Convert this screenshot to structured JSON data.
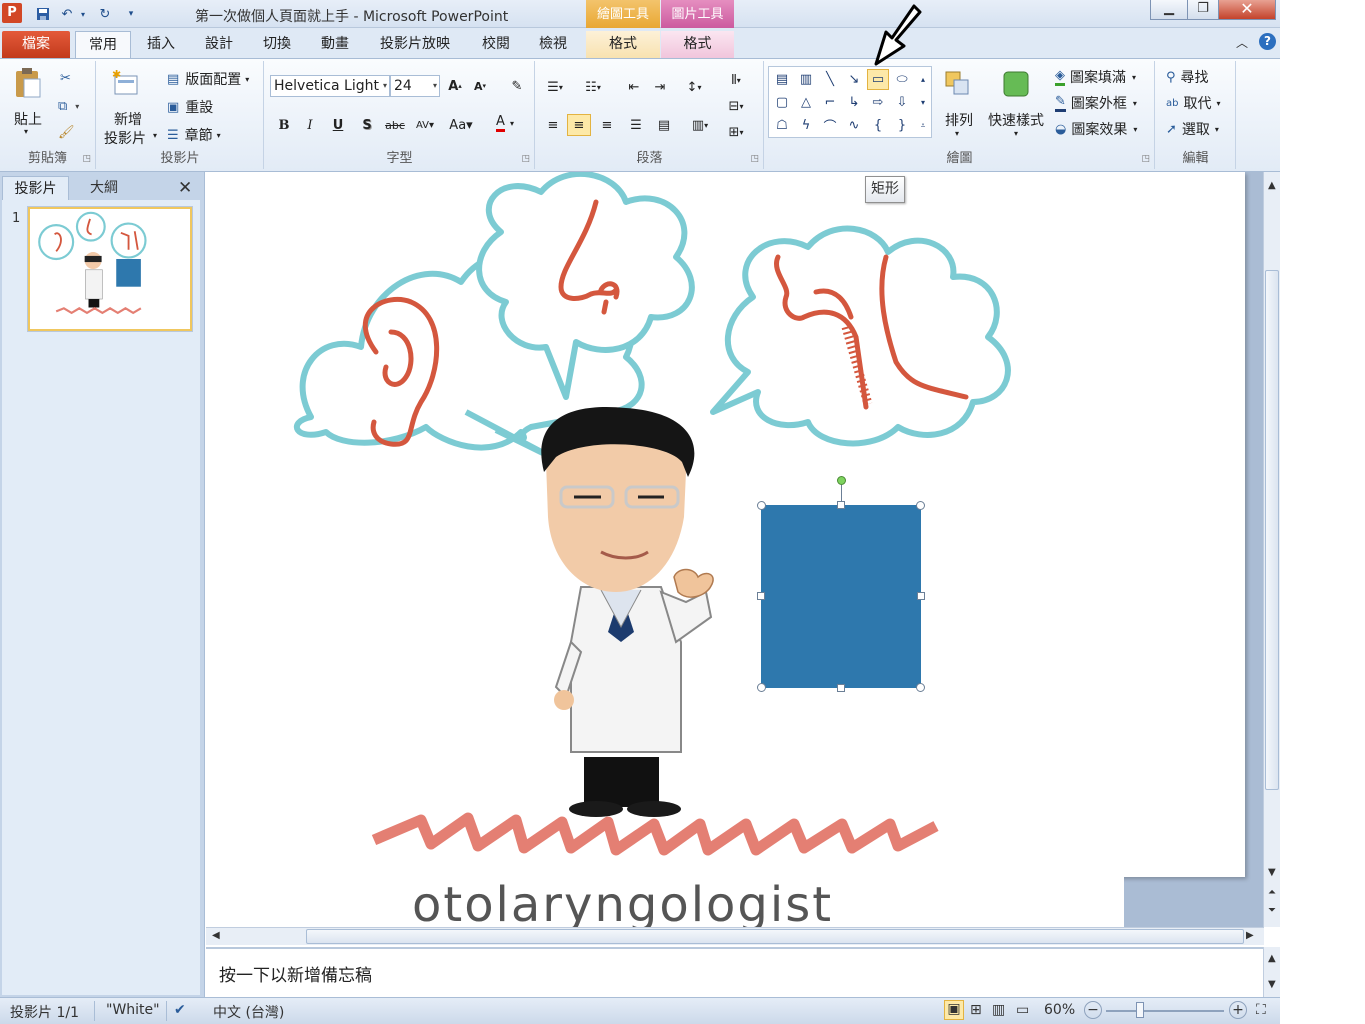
{
  "window": {
    "title": "第一次做個人頁面就上手 - Microsoft PowerPoint",
    "app_icon": "P",
    "context_headers": [
      "繪圖工具",
      "圖片工具"
    ]
  },
  "tabs": [
    "檔案",
    "常用",
    "插入",
    "設計",
    "切換",
    "動畫",
    "投影片放映",
    "校閱",
    "檢視",
    "格式",
    "格式"
  ],
  "ribbon": {
    "clipboard": {
      "paste": "貼上",
      "label": "剪貼簿"
    },
    "slides": {
      "new_slide_1": "新增",
      "new_slide_2": "投影片",
      "layout": "版面配置",
      "reset": "重設",
      "section": "章節",
      "label": "投影片"
    },
    "font": {
      "family": "Helvetica Light",
      "size": "24",
      "label": "字型"
    },
    "paragraph": {
      "label": "段落"
    },
    "drawing": {
      "arrange": "排列",
      "quick_styles": "快速樣式",
      "fill": "圖案填滿",
      "outline": "圖案外框",
      "effects": "圖案效果",
      "label": "繪圖"
    },
    "editing": {
      "find": "尋找",
      "replace": "取代",
      "select": "選取",
      "label": "編輯"
    }
  },
  "tooltip": "矩形",
  "left_panel": {
    "tab_slides": "投影片",
    "tab_outline": "大綱",
    "slide_number": "1"
  },
  "slide": {
    "caption": "otolaryngologist",
    "rect_color": "#2e78ad"
  },
  "notes": {
    "placeholder": "按一下以新增備忘稿"
  },
  "status": {
    "slide_info": "投影片 1/1",
    "theme": "\"White\"",
    "language": "中文 (台灣)",
    "zoom": "60%"
  },
  "colors": {
    "accent_file_tab": "#d24726",
    "cloud": "#7ccbd3",
    "organ": "#d4573e",
    "scribble": "#e47f73"
  }
}
